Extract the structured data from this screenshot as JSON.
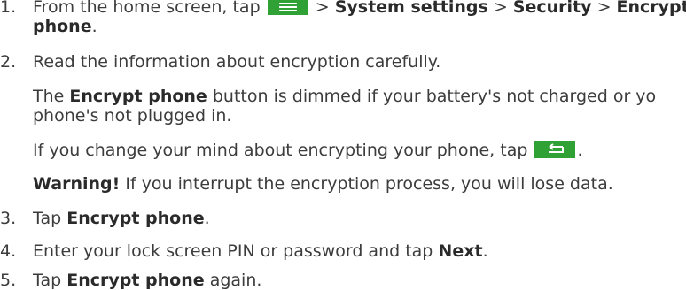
{
  "steps": [
    {
      "num": "1.",
      "pre": "From the home screen, tap",
      "mid": ">",
      "bold1": "System settings",
      "sep1": ">",
      "bold2": "Security",
      "sep2": ">",
      "bold3": "Encrypt",
      "bold3b": "phone",
      "post": "."
    },
    {
      "num": "2.",
      "text": "Read the information about encryption carefully.",
      "p1_bold": "Encrypt phone",
      "p1_rest": "button is dimmed if your battery's not charged or yo",
      "p1_pre": "The",
      "p1_line2": "phone's not plugged in.",
      "p2": "If you change your mind about encrypting your phone, tap",
      "p2_post": ".",
      "p3_bold": "Warning!",
      "p3_rest": "If you interrupt the encryption process, you will lose data."
    },
    {
      "num": "3.",
      "pre": "Tap",
      "bold": "Encrypt phone",
      "post": "."
    },
    {
      "num": "4.",
      "pre": "Enter your lock screen PIN or password and tap",
      "bold": "Next",
      "post": "."
    },
    {
      "num": "5.",
      "pre": "Tap",
      "bold": "Encrypt phone",
      "post": "again."
    }
  ],
  "icons": {
    "menu": "menu-icon",
    "back": "back-icon",
    "accent": "#2fa135"
  }
}
